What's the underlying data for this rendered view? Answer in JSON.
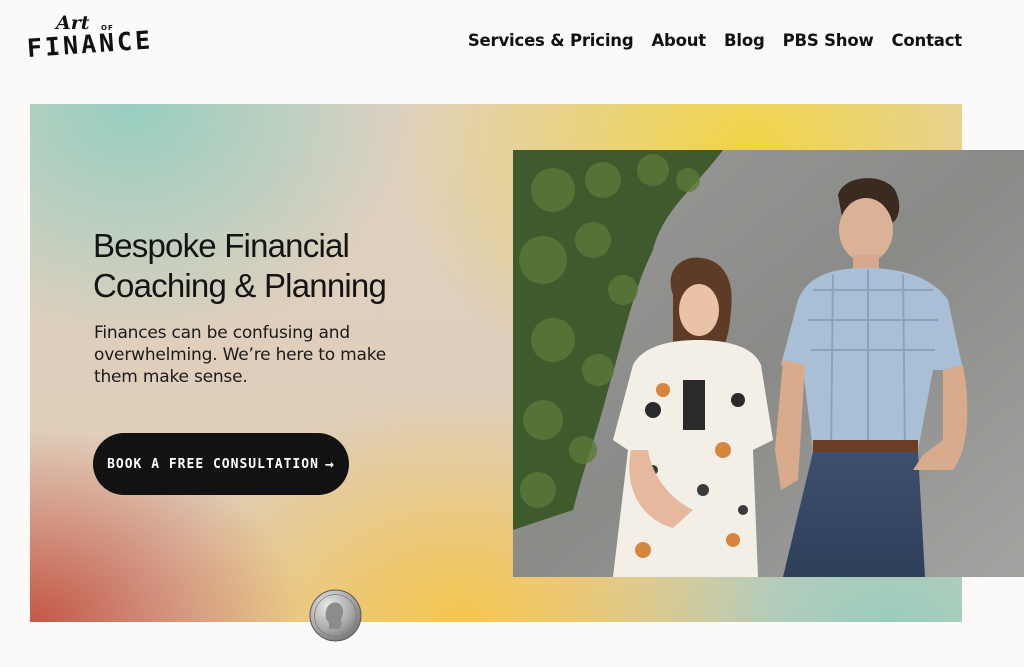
{
  "brand": {
    "art": "Art",
    "of": "OF",
    "finance": "FINANCE"
  },
  "nav": {
    "items": [
      {
        "label": "Services & Pricing"
      },
      {
        "label": "About"
      },
      {
        "label": "Blog"
      },
      {
        "label": "PBS Show"
      },
      {
        "label": "Contact"
      }
    ]
  },
  "hero": {
    "title_line1": "Bespoke Financial",
    "title_line2": "Coaching & Planning",
    "subtitle": "Finances can be confusing and overwhelming. We’re here to make them make sense.",
    "cta_label": "BOOK A FREE CONSULTATION",
    "cta_icon": "arrow-right-icon",
    "photo": "two-people-against-concrete-wall-with-ivy",
    "coin": "quarter-coin-icon"
  },
  "colors": {
    "teal": "#96cec0",
    "yellow": "#f2d441",
    "red": "#c45646",
    "button": "#121212"
  }
}
